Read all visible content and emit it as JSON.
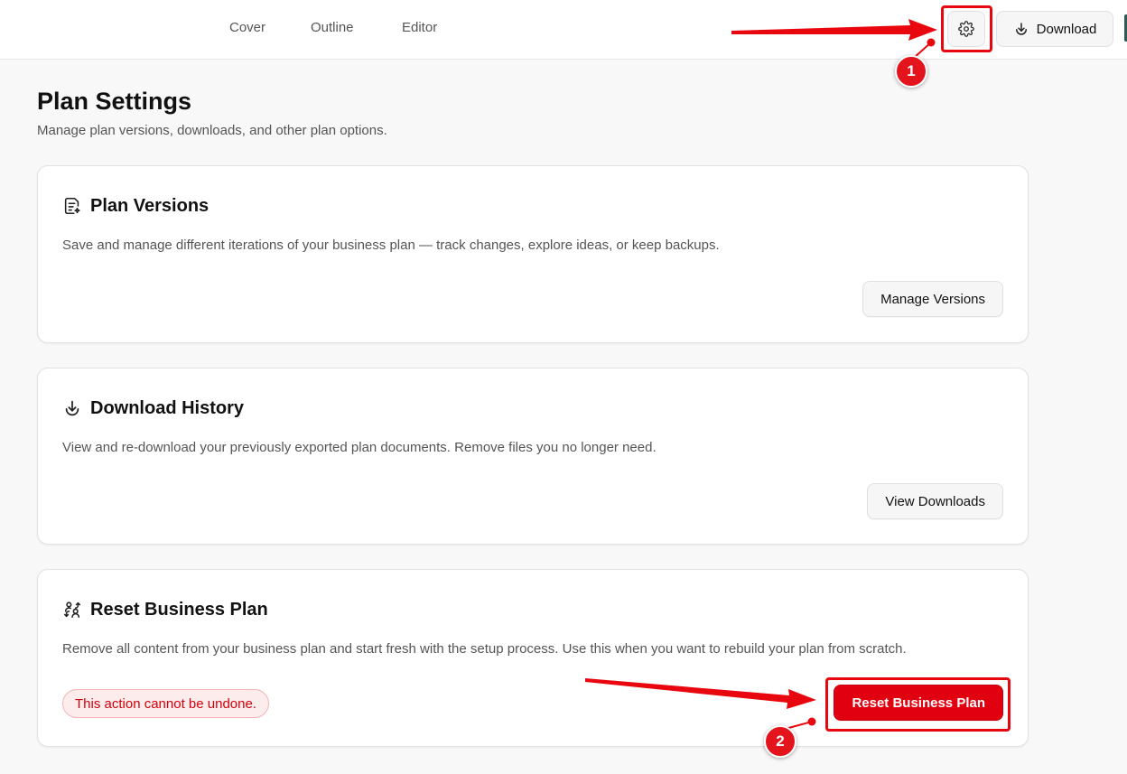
{
  "nav": {
    "tabs": [
      {
        "label": "Cover"
      },
      {
        "label": "Outline"
      },
      {
        "label": "Editor"
      }
    ],
    "settings_icon": "gear-icon",
    "download_label": "Download",
    "download_icon": "download-icon"
  },
  "page": {
    "title": "Plan Settings",
    "subtitle": "Manage plan versions, downloads, and other plan options."
  },
  "cards": {
    "versions": {
      "icon": "document-sparkle-icon",
      "title": "Plan Versions",
      "description": "Save and manage different iterations of your business plan — track changes, explore ideas, or keep backups.",
      "button": "Manage Versions"
    },
    "downloads": {
      "icon": "download-icon",
      "title": "Download History",
      "description": "View and re-download your previously exported plan documents. Remove files you no longer need.",
      "button": "View Downloads"
    },
    "reset": {
      "icon": "reset-people-icon",
      "title": "Reset Business Plan",
      "description": "Remove all content from your business plan and start fresh with the setup process. Use this when you want to rebuild your plan from scratch.",
      "warning": "This action cannot be undone.",
      "button": "Reset Business Plan"
    }
  },
  "annotations": {
    "marker_1": "1",
    "marker_2": "2",
    "color": "#e8070f"
  },
  "colors": {
    "danger": "#e0000f",
    "warning_text": "#d4000d",
    "warning_bg": "#fdecec"
  }
}
